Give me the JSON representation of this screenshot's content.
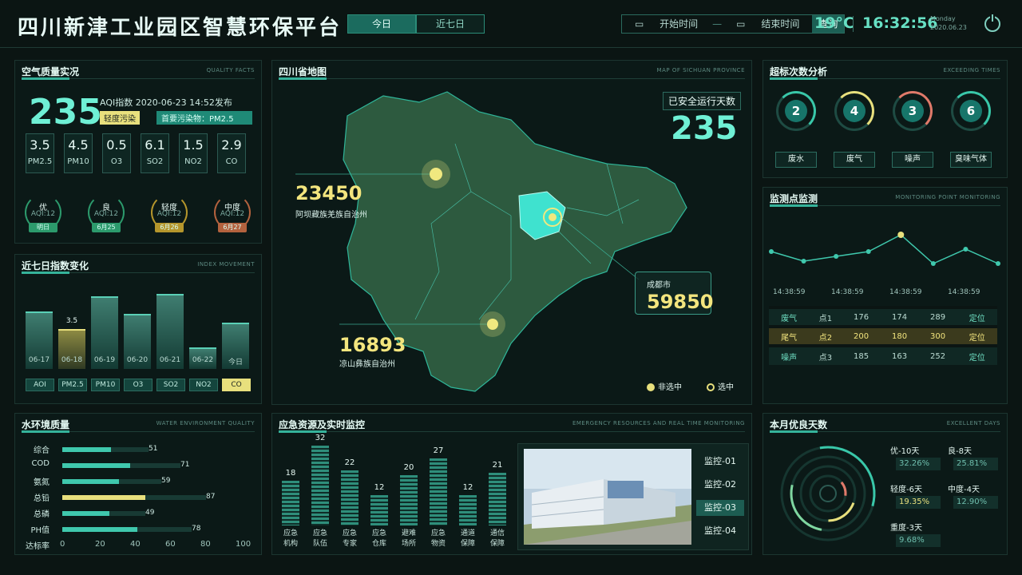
{
  "header": {
    "title": "四川新津工业园区智慧环保平台",
    "tabs": [
      {
        "label": "今日"
      },
      {
        "label": "近七日"
      }
    ],
    "start_time": "开始时间",
    "end_time": "结束时间",
    "query": "查询",
    "temperature": "19°C",
    "time": "16:32:56",
    "weekday": "Monday",
    "date": "2020.06.23"
  },
  "air": {
    "title": "空气质量实况",
    "subtitle": "QUALITY FACTS",
    "aqi": "235",
    "aqi_label": "AQI指数  2020-06-23 14:52发布",
    "level": "轻度污染",
    "pollutant": "首要污染物：PM2.5",
    "pollutants": [
      {
        "value": "3.5",
        "name": "PM2.5"
      },
      {
        "value": "4.5",
        "name": "PM10"
      },
      {
        "value": "0.5",
        "name": "O3"
      },
      {
        "value": "6.1",
        "name": "SO2"
      },
      {
        "value": "1.5",
        "name": "NO2"
      },
      {
        "value": "2.9",
        "name": "CO"
      }
    ],
    "forecast": [
      {
        "level": "优",
        "aqi": "AQI:12",
        "date": "明日",
        "color": "#2c9a6c"
      },
      {
        "level": "良",
        "aqi": "AQI:12",
        "date": "6月25",
        "color": "#2c9a6c"
      },
      {
        "level": "轻度",
        "aqi": "AQI:12",
        "date": "6月26",
        "color": "#b5962c"
      },
      {
        "level": "中度",
        "aqi": "AQI:12",
        "date": "6月27",
        "color": "#b3623e"
      }
    ]
  },
  "week": {
    "title": "近七日指数变化",
    "subtitle": "INDEX MOVEMENT",
    "highlight_value": "3.5",
    "bars": [
      {
        "label": "06-17",
        "value": 0.75
      },
      {
        "label": "06-18",
        "value": 0.52
      },
      {
        "label": "06-19",
        "value": 0.95
      },
      {
        "label": "06-20",
        "value": 0.72
      },
      {
        "label": "06-21",
        "value": 0.98
      },
      {
        "label": "06-22",
        "value": 0.28
      },
      {
        "label": "今日",
        "value": 0.6
      }
    ],
    "tabs": [
      "AOI",
      "PM2.5",
      "PM10",
      "O3",
      "SO2",
      "NO2",
      "CO"
    ]
  },
  "map": {
    "title": "四川省地图",
    "subtitle": "MAP OF SICHUAN PROVINCE",
    "safe_label": "已安全运行天数",
    "safe_days": "235",
    "aba_value": "23450",
    "aba_name": "阿坝藏族羌族自治州",
    "chengdu_name": "成都市",
    "chengdu_value": "59850",
    "liangshan_value": "16893",
    "liangshan_name": "凉山彝族自治州",
    "legend_unselected": "非选中",
    "legend_selected": "选中"
  },
  "exceed": {
    "title": "超标次数分析",
    "subtitle": "EXCEEDING TIMES",
    "items": [
      {
        "value": "2",
        "label": "废水",
        "color": "#39c7a9"
      },
      {
        "value": "4",
        "label": "废气",
        "color": "#e8e07d"
      },
      {
        "value": "3",
        "label": "噪声",
        "color": "#e07a6a"
      },
      {
        "value": "6",
        "label": "臭味气体",
        "color": "#39c7a9"
      }
    ]
  },
  "monitor": {
    "title": "监测点监测",
    "subtitle": "MONITORING POINT MONITORING",
    "times": [
      "14:38:59",
      "14:38:59",
      "14:38:59",
      "14:38:59"
    ],
    "line": [
      0.35,
      0.55,
      0.45,
      0.35,
      0.0,
      0.6,
      0.3,
      0.6
    ],
    "headers": [
      "类型",
      "监测点",
      "监测值",
      "日均值",
      "峰值",
      "操作"
    ],
    "rows": [
      [
        "废气",
        "点1",
        "176",
        "174",
        "289",
        "定位"
      ],
      [
        "尾气",
        "点2",
        "200",
        "180",
        "300",
        "定位"
      ],
      [
        "噪声",
        "点3",
        "185",
        "163",
        "252",
        "定位"
      ]
    ]
  },
  "water": {
    "title": "水环境质量",
    "subtitle": "WATER ENVIRONMENT QUALITY",
    "items": [
      {
        "name": "综合",
        "value": 51
      },
      {
        "name": "COD",
        "value": 71
      },
      {
        "name": "氨氮",
        "value": 59
      },
      {
        "name": "总铅",
        "value": 87
      },
      {
        "name": "总磷",
        "value": 49
      },
      {
        "name": "PH值",
        "value": 78
      }
    ],
    "axis_label": "达标率",
    "ticks": [
      "0",
      "20",
      "40",
      "60",
      "80",
      "100"
    ]
  },
  "emergency": {
    "title": "应急资源及实时监控",
    "subtitle": "EMERGENCY RESOURCES AND REAL TIME MONITORING",
    "bars": [
      {
        "name1": "应急",
        "name2": "机构",
        "value": 18
      },
      {
        "name1": "应急",
        "name2": "队伍",
        "value": 32
      },
      {
        "name1": "应急",
        "name2": "专家",
        "value": 22
      },
      {
        "name1": "应急",
        "name2": "仓库",
        "value": 12
      },
      {
        "name1": "避难",
        "name2": "场所",
        "value": 20
      },
      {
        "name1": "应急",
        "name2": "物资",
        "value": 27
      },
      {
        "name1": "通道",
        "name2": "保障",
        "value": 12
      },
      {
        "name1": "通信",
        "name2": "保障",
        "value": 21
      }
    ],
    "cameras": [
      "监控-01",
      "监控-02",
      "监控-03",
      "监控-04"
    ]
  },
  "gooddays": {
    "title": "本月优良天数",
    "subtitle": "EXCELLENT DAYS",
    "items": [
      {
        "label": "优-10天",
        "pct": "32.26%"
      },
      {
        "label": "良-8天",
        "pct": "25.81%"
      },
      {
        "label": "轻度-6天",
        "pct": "19.35%"
      },
      {
        "label": "中度-4天",
        "pct": "12.90%"
      },
      {
        "label": "重度-3天",
        "pct": "9.68%"
      }
    ]
  }
}
